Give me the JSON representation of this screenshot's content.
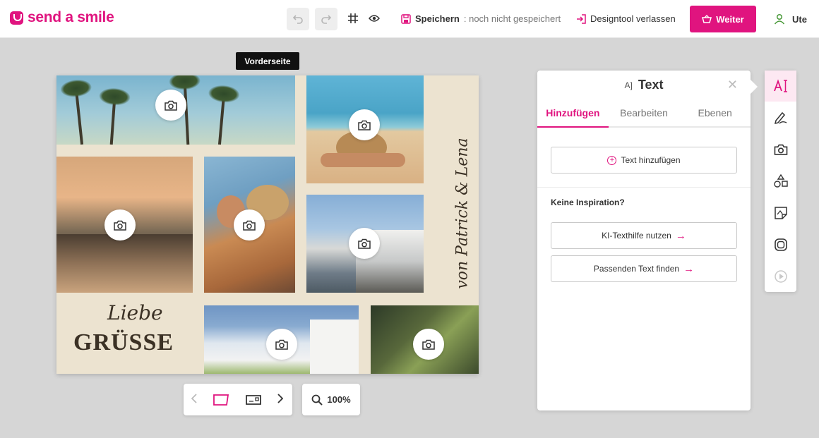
{
  "brand": {
    "name": "send a smile",
    "accent": "#e0147f"
  },
  "toolbar": {
    "save_label": "Speichern",
    "save_status": ": noch nicht gespeichert",
    "leave_label": "Designtool verlassen",
    "next_label": "Weiter",
    "user_name": "Ute",
    "icons": [
      "undo-icon",
      "redo-icon",
      "grid-icon",
      "eye-icon",
      "save-icon",
      "exit-icon",
      "basket-icon",
      "user-icon"
    ]
  },
  "canvas": {
    "side_label": "Vorderseite",
    "text_liebe": "Liebe",
    "text_gruesse": "GRÜSSE",
    "text_names": "von Patrick & Lena"
  },
  "zoom": {
    "level": "100%"
  },
  "panel": {
    "title": "Text",
    "tabs": [
      "Hinzufügen",
      "Bearbeiten",
      "Ebenen"
    ],
    "add_text_label": "Text hinzufügen",
    "inspiration_label": "Keine Inspiration?",
    "ai_help_label": "KI-Texthilfe nutzen",
    "find_text_label": "Passenden Text finden"
  },
  "rail": {
    "tools": [
      "text-tool-icon",
      "handwriting-icon",
      "camera-icon",
      "shapes-icon",
      "sticker-icon",
      "frame-icon",
      "play-icon"
    ]
  }
}
